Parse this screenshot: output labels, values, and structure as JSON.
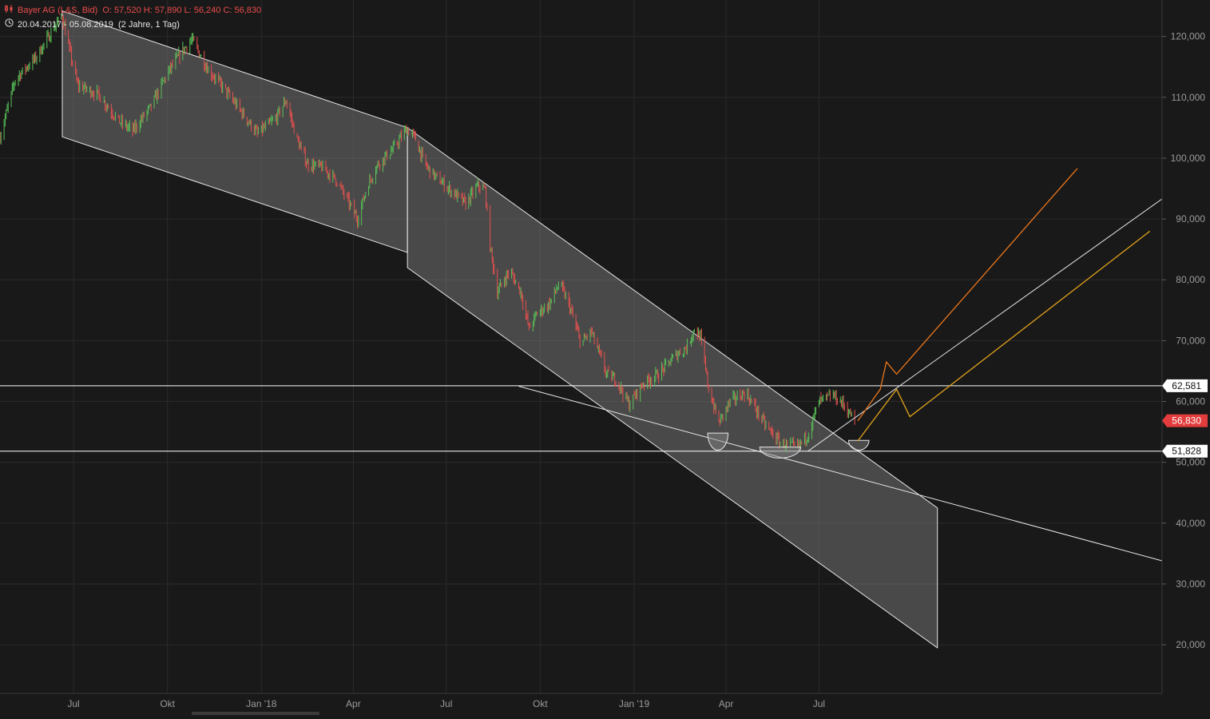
{
  "header": {
    "instrument": "Bayer AG (L&S, Bid)",
    "ohlc": "O: 57,520  H: 57,890  L: 56,240  C: 56,830",
    "range": "20.04.2017 - 05.08.2019",
    "period": "(2 Jahre, 1 Tag)",
    "instrument_icon": "candlestick-icon",
    "range_icon": "clock-icon"
  },
  "colors": {
    "background": "#1a1919",
    "grid": "#2b2a2a",
    "candle_up": "#57c157",
    "candle_down": "#e2514f",
    "trendline": "#e6e6e6",
    "channel_fill": "#7a7a7a",
    "projection_orange": "#e8761c",
    "projection_gold": "#e0a21a",
    "price_badge": "#e23c3c",
    "axis_text": "#9a9a9a"
  },
  "chart_data": {
    "type": "candlestick",
    "x_range": [
      "2017-04-20",
      "2020-06-01"
    ],
    "ylim": [
      12000,
      126000
    ],
    "y_ticks": [
      {
        "value": 20000,
        "label": "20,000"
      },
      {
        "value": 30000,
        "label": "30,000"
      },
      {
        "value": 40000,
        "label": "40,000"
      },
      {
        "value": 50000,
        "label": "50,000"
      },
      {
        "value": 60000,
        "label": "60,000"
      },
      {
        "value": 70000,
        "label": "70,000"
      },
      {
        "value": 80000,
        "label": "80,000"
      },
      {
        "value": 90000,
        "label": "90,000"
      },
      {
        "value": 100000,
        "label": "100,000"
      },
      {
        "value": 110000,
        "label": "110,000"
      },
      {
        "value": 120000,
        "label": "120,000"
      }
    ],
    "x_ticks": [
      {
        "date": "2017-07-01",
        "label": "Jul"
      },
      {
        "date": "2017-10-01",
        "label": "Okt"
      },
      {
        "date": "2018-01-01",
        "label": "Jan '18"
      },
      {
        "date": "2018-04-01",
        "label": "Apr"
      },
      {
        "date": "2018-07-01",
        "label": "Jul"
      },
      {
        "date": "2018-10-01",
        "label": "Okt"
      },
      {
        "date": "2019-01-01",
        "label": "Jan '19"
      },
      {
        "date": "2019-04-01",
        "label": "Apr"
      },
      {
        "date": "2019-07-01",
        "label": "Jul"
      }
    ],
    "price_path": [
      [
        "2017-04-20",
        103500
      ],
      [
        "2017-05-05",
        113000
      ],
      [
        "2017-05-25",
        116500
      ],
      [
        "2017-06-12",
        121500
      ],
      [
        "2017-06-20",
        123300
      ],
      [
        "2017-06-26",
        118500
      ],
      [
        "2017-07-05",
        112000
      ],
      [
        "2017-07-25",
        110500
      ],
      [
        "2017-08-15",
        106000
      ],
      [
        "2017-08-28",
        104500
      ],
      [
        "2017-09-15",
        108500
      ],
      [
        "2017-10-01",
        114000
      ],
      [
        "2017-10-15",
        117500
      ],
      [
        "2017-10-25",
        119500
      ],
      [
        "2017-11-10",
        114500
      ],
      [
        "2017-11-25",
        111500
      ],
      [
        "2017-12-15",
        107000
      ],
      [
        "2017-12-28",
        104000
      ],
      [
        "2018-01-15",
        106500
      ],
      [
        "2018-01-25",
        109500
      ],
      [
        "2018-02-05",
        103000
      ],
      [
        "2018-02-15",
        99000
      ],
      [
        "2018-03-01",
        98500
      ],
      [
        "2018-03-15",
        96500
      ],
      [
        "2018-03-25",
        93500
      ],
      [
        "2018-04-05",
        90000
      ],
      [
        "2018-04-15",
        95500
      ],
      [
        "2018-04-25",
        99000
      ],
      [
        "2018-05-10",
        101500
      ],
      [
        "2018-05-23",
        104800
      ],
      [
        "2018-05-31",
        103500
      ],
      [
        "2018-06-10",
        99000
      ],
      [
        "2018-06-20",
        97000
      ],
      [
        "2018-07-10",
        94000
      ],
      [
        "2018-07-20",
        92500
      ],
      [
        "2018-08-01",
        95500
      ],
      [
        "2018-08-08",
        94800
      ],
      [
        "2018-08-13",
        85500
      ],
      [
        "2018-08-20",
        78000
      ],
      [
        "2018-09-01",
        81500
      ],
      [
        "2018-09-12",
        78000
      ],
      [
        "2018-09-20",
        72000
      ],
      [
        "2018-09-28",
        74500
      ],
      [
        "2018-10-10",
        76000
      ],
      [
        "2018-10-20",
        79500
      ],
      [
        "2018-10-30",
        75500
      ],
      [
        "2018-11-10",
        69500
      ],
      [
        "2018-11-20",
        71500
      ],
      [
        "2018-12-05",
        64500
      ],
      [
        "2018-12-15",
        63500
      ],
      [
        "2018-12-27",
        59500
      ],
      [
        "2019-01-10",
        63000
      ],
      [
        "2019-01-25",
        64500
      ],
      [
        "2019-02-10",
        67500
      ],
      [
        "2019-02-22",
        69000
      ],
      [
        "2019-03-01",
        72000
      ],
      [
        "2019-03-07",
        70500
      ],
      [
        "2019-03-15",
        62000
      ],
      [
        "2019-03-25",
        56500
      ],
      [
        "2019-04-05",
        60000
      ],
      [
        "2019-04-20",
        61500
      ],
      [
        "2019-05-01",
        58500
      ],
      [
        "2019-05-10",
        56000
      ],
      [
        "2019-05-25",
        53000
      ],
      [
        "2019-06-10",
        52500
      ],
      [
        "2019-06-20",
        54500
      ],
      [
        "2019-07-01",
        60000
      ],
      [
        "2019-07-15",
        61000
      ],
      [
        "2019-07-25",
        59500
      ],
      [
        "2019-08-05",
        56830
      ]
    ],
    "lines": [
      {
        "kind": "horizontal",
        "value": 62581,
        "label": "62,581",
        "color": "#ffffff"
      },
      {
        "kind": "horizontal",
        "value": 51828,
        "label": "51,828",
        "color": "#ffffff"
      },
      {
        "kind": "last-price",
        "value": 56830,
        "label": "56,830",
        "color": "#e23c3c"
      }
    ],
    "channels": [
      {
        "points": [
          [
            "2017-06-20",
            124200
          ],
          [
            "2018-05-24",
            105000
          ],
          [
            "2018-05-24",
            84500
          ],
          [
            "2017-06-20",
            103500
          ]
        ]
      },
      {
        "points": [
          [
            "2018-05-24",
            105000
          ],
          [
            "2019-10-25",
            42500
          ],
          [
            "2019-10-25",
            19500
          ],
          [
            "2018-05-24",
            82000
          ]
        ]
      }
    ],
    "segments": [
      {
        "from": [
          "2018-09-10",
          62500
        ],
        "to": [
          "2020-06-01",
          33800
        ],
        "color": "#e6e6e6"
      },
      {
        "from": [
          "2019-06-20",
          51800
        ],
        "to": [
          "2020-06-01",
          93300
        ],
        "color": "#e6e6e6"
      }
    ],
    "projections": [
      {
        "color": "#e8761c",
        "points": [
          [
            "2019-08-08",
            56800
          ],
          [
            "2019-08-30",
            62000
          ],
          [
            "2019-09-05",
            66500
          ],
          [
            "2019-09-15",
            64500
          ],
          [
            "2020-03-10",
            98300
          ]
        ]
      },
      {
        "color": "#e0a21a",
        "points": [
          [
            "2019-08-08",
            53500
          ],
          [
            "2019-09-15",
            62000
          ],
          [
            "2019-09-28",
            57500
          ],
          [
            "2020-05-20",
            88000
          ]
        ]
      }
    ],
    "arcs": [
      {
        "center": [
          "2019-03-24",
          54800
        ],
        "half_width_days": 10,
        "depth": 2800
      },
      {
        "center": [
          "2019-05-24",
          52500
        ],
        "half_width_days": 20,
        "depth": 1800
      },
      {
        "center": [
          "2019-08-09",
          53600
        ],
        "half_width_days": 10,
        "depth": 1600
      }
    ]
  }
}
